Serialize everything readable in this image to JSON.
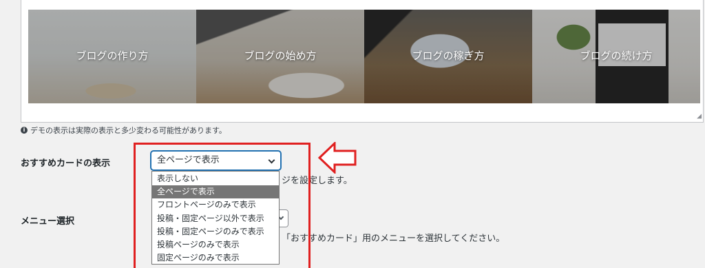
{
  "preview": {
    "cards": [
      {
        "label": "ブログの作り方"
      },
      {
        "label": "ブログの始め方"
      },
      {
        "label": "ブログの稼ぎ方"
      },
      {
        "label": "ブログの続け方"
      }
    ]
  },
  "notice": {
    "icon": "info-icon",
    "text": "デモの表示は実際の表示と多少変わる可能性があります。"
  },
  "recommend_card": {
    "label": "おすすめカードの表示",
    "selected_value": "全ページで表示",
    "description_partial": "ジを設定します。",
    "options": [
      "表示しない",
      "全ページで表示",
      "フロントページのみで表示",
      "投稿・固定ページ以外で表示",
      "投稿・固定ページのみで表示",
      "投稿ページのみで表示",
      "固定ページのみで表示"
    ],
    "selected_index": 1
  },
  "menu_select": {
    "label": "メニュー選択",
    "description_partial": "「おすすめカード」用のメニューを選択してください。"
  },
  "annotation": {
    "color": "#e02020"
  }
}
